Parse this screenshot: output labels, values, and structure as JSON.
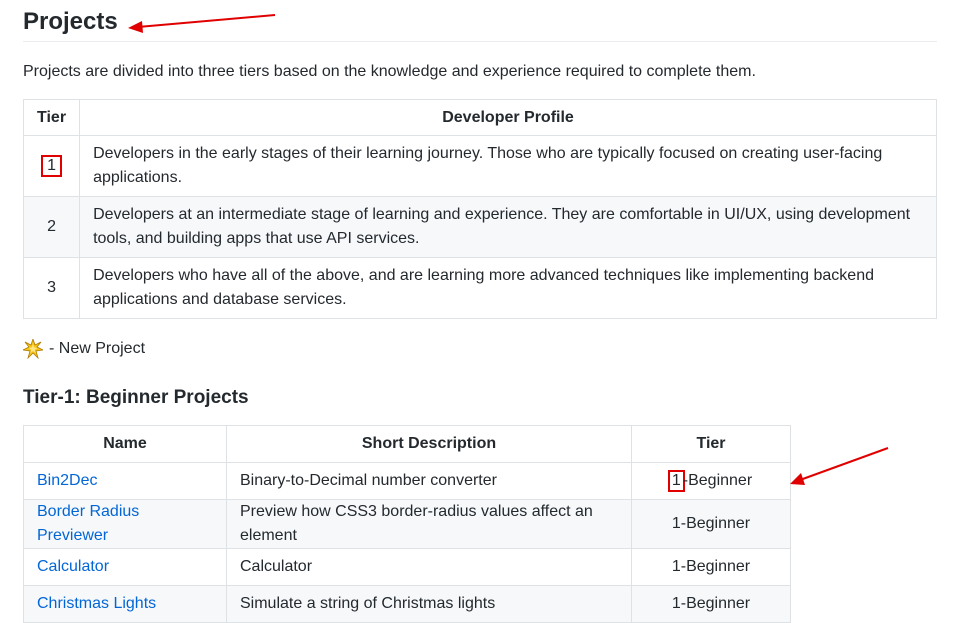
{
  "page": {
    "title": "Projects",
    "intro": "Projects are divided into three tiers based on the knowledge and experience required to complete them."
  },
  "tiers_table": {
    "headers": [
      "Tier",
      "Developer Profile"
    ],
    "rows": [
      {
        "tier": "1",
        "profile": "Developers in the early stages of their learning journey. Those who are typically focused on creating user-facing applications."
      },
      {
        "tier": "2",
        "profile": "Developers at an intermediate stage of learning and experience. They are comfortable in UI/UX, using development tools, and building apps that use API services."
      },
      {
        "tier": "3",
        "profile": "Developers who have all of the above, and are learning more advanced techniques like implementing backend applications and database services."
      }
    ]
  },
  "legend": {
    "icon": "new-project-star-icon",
    "text": "- New Project"
  },
  "tier1": {
    "heading": "Tier-1: Beginner Projects",
    "headers": [
      "Name",
      "Short Description",
      "Tier"
    ],
    "rows": [
      {
        "name": "Bin2Dec",
        "description": "Binary-to-Decimal number converter",
        "tier_num": "1",
        "tier_rest": "-Beginner"
      },
      {
        "name": "Border Radius Previewer",
        "description": "Preview how CSS3 border-radius values affect an element",
        "tier": "1-Beginner"
      },
      {
        "name": "Calculator",
        "description": "Calculator",
        "tier": "1-Beginner"
      },
      {
        "name": "Christmas Lights",
        "description": "Simulate a string of Christmas lights",
        "tier": "1-Beginner"
      }
    ]
  },
  "annotations": {
    "arrow_color": "#e00000",
    "highlight_color": "#e00000"
  }
}
